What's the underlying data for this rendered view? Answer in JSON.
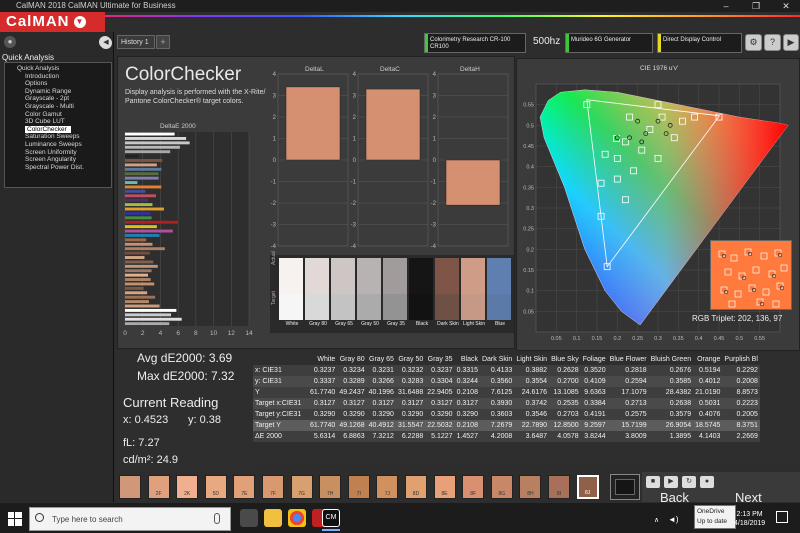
{
  "window": {
    "title": "CalMAN 2018 CalMAN Ultimate for Business",
    "logo": "CalMAN",
    "controls": [
      "–",
      "❐",
      "✕"
    ]
  },
  "left_panel": {
    "heading": "Quick Analysis",
    "items": [
      {
        "label": "Quick Analysis",
        "head": true
      },
      {
        "label": "Introduction"
      },
      {
        "label": "Options"
      },
      {
        "label": "Dynamic Range"
      },
      {
        "label": "Grayscale - 2pt"
      },
      {
        "label": "Grayscale - Multi"
      },
      {
        "label": "Color Gamut"
      },
      {
        "label": "3D Cube LUT"
      },
      {
        "label": "ColorChecker",
        "selected": true
      },
      {
        "label": "Saturation Sweeps"
      },
      {
        "label": "Luminance Sweeps"
      },
      {
        "label": "Screen Uniformity"
      },
      {
        "label": "Screen Angularity"
      },
      {
        "label": "Spectral Power Dist."
      }
    ]
  },
  "tabs": {
    "history": "History 1",
    "add": "+"
  },
  "devices": {
    "meter": {
      "line1": "Colorimetry Research CR-100",
      "line2": "CR100",
      "color": "#3cc83c"
    },
    "refresh": "500hz",
    "generator": {
      "line1": "Murideo 6G Generator",
      "color": "#3cc83c"
    },
    "display": {
      "line1": "Direct Display Control",
      "color": "#e8d820"
    }
  },
  "main": {
    "title": "ColorChecker",
    "description": "Display analysis is performed with the X-Rite/ Pantone ColorChecker® target colors.",
    "de2000_title": "DeltaE 2000",
    "deltaL_title": "DeltaL",
    "deltaC_title": "DeltaC",
    "deltaH_title": "DeltaH",
    "actual_label": "Actual",
    "target_label": "Target"
  },
  "chart_data": [
    {
      "type": "bar",
      "title": "DeltaE 2000",
      "orientation": "horizontal",
      "xlim": [
        0,
        14
      ],
      "ticks": [
        0,
        2,
        4,
        6,
        8,
        10,
        12,
        14
      ],
      "bars": [
        {
          "value": 5.6,
          "color": "#ffffff"
        },
        {
          "value": 6.9,
          "color": "#d8d8d8"
        },
        {
          "value": 7.3,
          "color": "#c8c8c8"
        },
        {
          "value": 6.2,
          "color": "#b8b8b8"
        },
        {
          "value": 5.1,
          "color": "#a8a8a8"
        },
        {
          "value": 1.5,
          "color": "#222222"
        },
        {
          "value": 4.2,
          "color": "#7a5440"
        },
        {
          "value": 3.6,
          "color": "#d2a080"
        },
        {
          "value": 4.1,
          "color": "#5c7aa0"
        },
        {
          "value": 3.8,
          "color": "#5a6c40"
        },
        {
          "value": 3.8,
          "color": "#8080b0"
        },
        {
          "value": 1.4,
          "color": "#60c0b0"
        },
        {
          "value": 4.1,
          "color": "#e08030"
        },
        {
          "value": 2.3,
          "color": "#4050a0"
        },
        {
          "value": 3.5,
          "color": "#c05060"
        },
        {
          "value": 2.6,
          "color": "#503060"
        },
        {
          "value": 3.1,
          "color": "#a0c040"
        },
        {
          "value": 4.4,
          "color": "#e0a030"
        },
        {
          "value": 2.9,
          "color": "#3030a0"
        },
        {
          "value": 3.0,
          "color": "#409040"
        },
        {
          "value": 6.0,
          "color": "#b02020"
        },
        {
          "value": 3.6,
          "color": "#e0c020"
        },
        {
          "value": 5.4,
          "color": "#b050a0"
        },
        {
          "value": 3.9,
          "color": "#2080b0"
        },
        {
          "value": 2.4,
          "color": "#a06848"
        },
        {
          "value": 3.1,
          "color": "#c89070"
        },
        {
          "value": 4.5,
          "color": "#b08060"
        },
        {
          "value": 2.8,
          "color": "#705040"
        },
        {
          "value": 2.2,
          "color": "#d0a888"
        },
        {
          "value": 3.2,
          "color": "#806050"
        },
        {
          "value": 3.7,
          "color": "#c09878"
        },
        {
          "value": 3.0,
          "color": "#9a7a62"
        },
        {
          "value": 2.6,
          "color": "#e0b090"
        },
        {
          "value": 2.9,
          "color": "#aa8266"
        },
        {
          "value": 3.3,
          "color": "#c88e6a"
        },
        {
          "value": 2.1,
          "color": "#7a5a46"
        },
        {
          "value": 2.5,
          "color": "#d8a482"
        },
        {
          "value": 3.4,
          "color": "#9c7256"
        },
        {
          "value": 2.7,
          "color": "#b48868"
        },
        {
          "value": 3.9,
          "color": "#cc9c7c"
        },
        {
          "value": 5.8,
          "color": "#ffffff"
        },
        {
          "value": 5.2,
          "color": "#cccccc"
        },
        {
          "value": 6.4,
          "color": "#e0e0e0"
        },
        {
          "value": 5.0,
          "color": "#aaaaaa"
        }
      ]
    },
    {
      "type": "bar",
      "title": "DeltaL",
      "ylim": [
        -4,
        4
      ],
      "ticks": [
        4,
        3,
        2,
        1,
        0,
        -1,
        -2,
        -3,
        -4
      ],
      "values": [
        3.4
      ]
    },
    {
      "type": "bar",
      "title": "DeltaC",
      "ylim": [
        -4,
        4
      ],
      "ticks": [
        4,
        3,
        2,
        1,
        0,
        -1,
        -2,
        -3,
        -4
      ],
      "values": [
        3.3
      ]
    },
    {
      "type": "bar",
      "title": "DeltaH",
      "ylim": [
        -4,
        4
      ],
      "ticks": [
        4,
        3,
        2,
        1,
        0,
        -1,
        -2,
        -3,
        -4
      ],
      "values": [
        -2.1
      ]
    },
    {
      "type": "scatter",
      "title": "CIE 1976 u'v'",
      "xlim": [
        0,
        0.6
      ],
      "ylim": [
        0,
        0.6
      ],
      "xticks": [
        "0.05",
        "0.1",
        "0.15",
        "0.2",
        "0.25",
        "0.3",
        "0.35",
        "0.4",
        "0.45",
        "0.5",
        "0.55"
      ],
      "yticks": [
        "0.05",
        "0.1",
        "0.15",
        "0.2",
        "0.25",
        "0.3",
        "0.35",
        "0.4",
        "0.45",
        "0.5",
        "0.55"
      ],
      "gamut": [
        [
          0.451,
          0.523
        ],
        [
          0.125,
          0.562
        ],
        [
          0.175,
          0.158
        ]
      ],
      "targets": [
        [
          0.198,
          0.468
        ],
        [
          0.31,
          0.52
        ],
        [
          0.23,
          0.52
        ],
        [
          0.36,
          0.51
        ],
        [
          0.28,
          0.49
        ],
        [
          0.22,
          0.46
        ],
        [
          0.34,
          0.47
        ],
        [
          0.26,
          0.44
        ],
        [
          0.17,
          0.43
        ],
        [
          0.2,
          0.42
        ],
        [
          0.3,
          0.42
        ],
        [
          0.24,
          0.39
        ],
        [
          0.2,
          0.37
        ],
        [
          0.16,
          0.36
        ],
        [
          0.22,
          0.32
        ],
        [
          0.16,
          0.28
        ],
        [
          0.175,
          0.158
        ],
        [
          0.45,
          0.52
        ],
        [
          0.39,
          0.52
        ],
        [
          0.125,
          0.55
        ],
        [
          0.3,
          0.55
        ]
      ],
      "actuals": [
        [
          0.2,
          0.47
        ],
        [
          0.3,
          0.51
        ],
        [
          0.25,
          0.51
        ],
        [
          0.33,
          0.5
        ],
        [
          0.27,
          0.48
        ],
        [
          0.23,
          0.47
        ],
        [
          0.32,
          0.48
        ],
        [
          0.26,
          0.46
        ]
      ]
    }
  ],
  "actual_swatches": [
    {
      "label": "White",
      "color": "#f7f1ef"
    },
    {
      "label": "Gray 80",
      "color": "#e2d9d7"
    },
    {
      "label": "Gray 65",
      "color": "#cdc6c5"
    },
    {
      "label": "Gray 50",
      "color": "#b8b3b2"
    },
    {
      "label": "Gray 35",
      "color": "#a19c9b"
    },
    {
      "label": "Black",
      "color": "#151515"
    },
    {
      "label": "Dark Skin",
      "color": "#7e5546"
    },
    {
      "label": "Light Skin",
      "color": "#cf9c88"
    },
    {
      "label": "Blue",
      "color": "#5f7fb0"
    }
  ],
  "target_swatches": [
    "#f6f6f6",
    "#d9d9d9",
    "#c3c3c3",
    "#ababab",
    "#939393",
    "#121212",
    "#6e5144",
    "#c69987",
    "#5c7aa8"
  ],
  "rgb_triplet": "RGB Triplet: 202, 136, 97",
  "stats": {
    "avg": "Avg dE2000: 3.69",
    "max": "Max dE2000: 7.32",
    "current": "Current Reading",
    "x": "x: 0.4523",
    "y": "y: 0.38",
    "fl": "fL: 7.27",
    "cdm2": "cd/m²: 24.9"
  },
  "table": {
    "headers": [
      "",
      "White",
      "Gray 80",
      "Gray 65",
      "Gray 50",
      "Gray 35",
      "Black",
      "Dark Skin",
      "Light Skin",
      "Blue Sky",
      "Foliage",
      "Blue Flower",
      "Bluish Green",
      "Orange",
      "Purplish Bl"
    ],
    "rows": [
      {
        "cls": "r0",
        "cells": [
          "x: CIE31",
          "0.3237",
          "0.3234",
          "0.3231",
          "0.3232",
          "0.3237",
          "0.3315",
          "0.4133",
          "0.3882",
          "0.2628",
          "0.3520",
          "0.2818",
          "0.2676",
          "0.5194",
          "0.2292"
        ]
      },
      {
        "cls": "r1",
        "cells": [
          "y: CIE31",
          "0.3337",
          "0.3289",
          "0.3266",
          "0.3283",
          "0.3304",
          "0.3244",
          "0.3560",
          "0.3554",
          "0.2700",
          "0.4109",
          "0.2594",
          "0.3585",
          "0.4012",
          "0.2008"
        ]
      },
      {
        "cls": "r0",
        "cells": [
          "Y",
          "61.7740",
          "49.2437",
          "40.1996",
          "31.6488",
          "22.9405",
          "0.2108",
          "7.6125",
          "24.6176",
          "13.1085",
          "9.6363",
          "17.1079",
          "28.4382",
          "21.0190",
          "8.8573"
        ]
      },
      {
        "cls": "r1",
        "cells": [
          "Target x:CIE31",
          "0.3127",
          "0.3127",
          "0.3127",
          "0.3127",
          "0.3127",
          "0.3127",
          "0.3930",
          "0.3742",
          "0.2535",
          "0.3384",
          "0.2713",
          "0.2638",
          "0.5031",
          "0.2223"
        ]
      },
      {
        "cls": "r0",
        "cells": [
          "Target y:CIE31",
          "0.3290",
          "0.3290",
          "0.3290",
          "0.3290",
          "0.3290",
          "0.3290",
          "0.3603",
          "0.3546",
          "0.2703",
          "0.4191",
          "0.2575",
          "0.3579",
          "0.4076",
          "0.2005"
        ]
      },
      {
        "cls": "rt",
        "cells": [
          "Target Y",
          "61.7740",
          "49.1268",
          "40.4912",
          "31.5547",
          "22.5032",
          "0.2108",
          "7.2679",
          "22.7890",
          "12.8500",
          "9.2597",
          "15.7199",
          "26.9054",
          "18.5745",
          "8.3751"
        ]
      },
      {
        "cls": "r0",
        "cells": [
          "ΔE 2000",
          "5.6314",
          "6.8863",
          "7.3212",
          "6.2288",
          "5.1227",
          "1.4527",
          "4.2008",
          "3.6487",
          "4.0578",
          "3.8244",
          "3.8009",
          "1.3895",
          "4.1403",
          "2.2669"
        ]
      }
    ]
  },
  "bottom_swatches": [
    {
      "label": "",
      "color": "#d09878"
    },
    {
      "label": "2F",
      "color": "#e0a080"
    },
    {
      "label": "2K",
      "color": "#f0b090"
    },
    {
      "label": "5D",
      "color": "#e8a880"
    },
    {
      "label": "7E",
      "color": "#e0a078"
    },
    {
      "label": "7F",
      "color": "#d89870"
    },
    {
      "label": "7G",
      "color": "#d8a070"
    },
    {
      "label": "7H",
      "color": "#c89060"
    },
    {
      "label": "7I",
      "color": "#c08050"
    },
    {
      "label": "7J",
      "color": "#d09060"
    },
    {
      "label": "8D",
      "color": "#e0a070"
    },
    {
      "label": "8E",
      "color": "#e8a078"
    },
    {
      "label": "8F",
      "color": "#d89070"
    },
    {
      "label": "8G",
      "color": "#c88868"
    },
    {
      "label": "8H",
      "color": "#b88060"
    },
    {
      "label": "8I",
      "color": "#a87058"
    },
    {
      "label": "8J",
      "color": "#906048"
    }
  ],
  "nav": {
    "back": "Back",
    "next": "Next"
  },
  "taskbar": {
    "search_placeholder": "Type here to search",
    "tooltip_line1": "OneDrive",
    "tooltip_line2": "Up to date",
    "time": "2:13 PM",
    "date": "4/18/2019"
  }
}
